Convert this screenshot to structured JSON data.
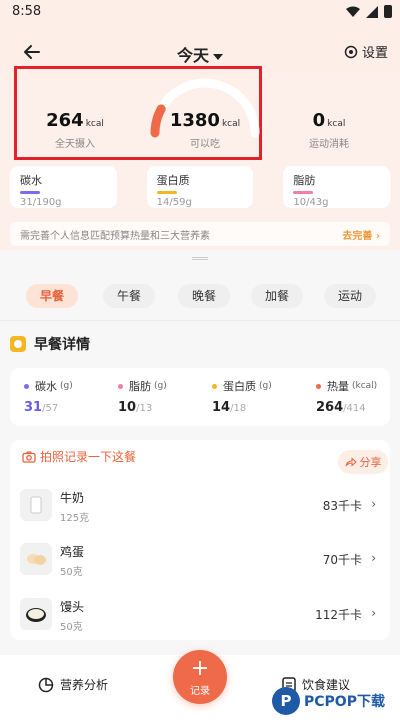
{
  "status": {
    "time": "8:58"
  },
  "header": {
    "title": "今天",
    "settings_label": "设置"
  },
  "summary": {
    "intake": {
      "value": "264",
      "unit": "kcal",
      "label": "全天摄入"
    },
    "remaining": {
      "value": "1380",
      "unit": "kcal",
      "label": "可以吃"
    },
    "burned": {
      "value": "0",
      "unit": "kcal",
      "label": "运动消耗"
    },
    "gauge_fraction": 0.16
  },
  "macros": [
    {
      "name": "碳水",
      "value": "31/190g",
      "color": "#7b6cf0"
    },
    {
      "name": "蛋白质",
      "value": "14/59g",
      "color": "#f4b723"
    },
    {
      "name": "脂肪",
      "value": "10/43g",
      "color": "#f07fa0"
    }
  ],
  "notice": {
    "text": "需完善个人信息匹配预算热量和三大营养素",
    "link": "去完善 ›"
  },
  "meal_tabs": [
    "早餐",
    "午餐",
    "晚餐",
    "加餐",
    "运动"
  ],
  "active_tab": "早餐",
  "breakfast": {
    "title": "早餐详情",
    "nutrients": [
      {
        "name": "碳水",
        "unit": "(g)",
        "value": "31",
        "total": "/57",
        "color": "#7b6cf0",
        "valcolor": "#6a5cf0"
      },
      {
        "name": "脂肪",
        "unit": "(g)",
        "value": "10",
        "total": "/13",
        "color": "#f07fa0",
        "valcolor": "#222"
      },
      {
        "name": "蛋白质",
        "unit": "(g)",
        "value": "14",
        "total": "/18",
        "color": "#f4b723",
        "valcolor": "#222"
      },
      {
        "name": "热量",
        "unit": "(kcal)",
        "value": "264",
        "total": "/414",
        "color": "#ef6a48",
        "valcolor": "#222"
      }
    ],
    "photo_prompt": "拍照记录一下这餐",
    "share_label": "分享",
    "foods": [
      {
        "name": "牛奶",
        "qty": "125克",
        "kcal": "83千卡"
      },
      {
        "name": "鸡蛋",
        "qty": "50克",
        "kcal": "70千卡"
      },
      {
        "name": "馒头",
        "qty": "50克",
        "kcal": "112千卡"
      }
    ]
  },
  "bottom_nav": {
    "left": "营养分析",
    "center": "记录",
    "right": "饮食建议"
  },
  "watermark": {
    "logo": "P",
    "text": "PCPOP下载"
  }
}
